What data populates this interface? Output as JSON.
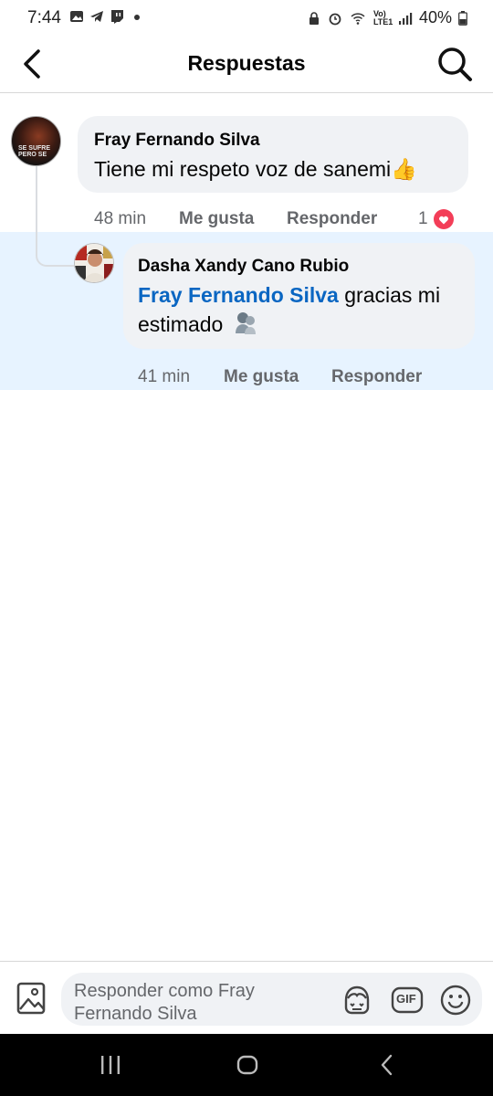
{
  "status_bar": {
    "time": "7:44",
    "battery": "40%",
    "network_label": "Vo) LTE1"
  },
  "header": {
    "title": "Respuestas",
    "back_icon": "chevron-left-icon",
    "search_icon": "search-icon"
  },
  "comments": [
    {
      "author": "Fray Fernando Silva",
      "avatar_text": "SE SUFRE PERO SE",
      "text": "Tiene mi respeto voz de sanemi",
      "emoji": "👍",
      "time": "48 min",
      "like_label": "Me gusta",
      "reply_label": "Responder",
      "reaction_count": "1"
    }
  ],
  "replies": [
    {
      "author": "Dasha Xandy Cano Rubio",
      "mention": "Fray Fernando Silva",
      "text_line1": " gracias mi",
      "text_line2": "estimado",
      "time": "41 min",
      "like_label": "Me gusta",
      "reply_label": "Responder"
    }
  ],
  "composer": {
    "placeholder_line1": "Responder como Fray",
    "placeholder_line2": "Fernando Silva",
    "gif_label": "GIF"
  },
  "colors": {
    "mention_blue": "#0a66c2",
    "reply_highlight": "#e7f3ff",
    "bubble_gray": "#f0f2f5",
    "heart_red": "#f33e58"
  }
}
